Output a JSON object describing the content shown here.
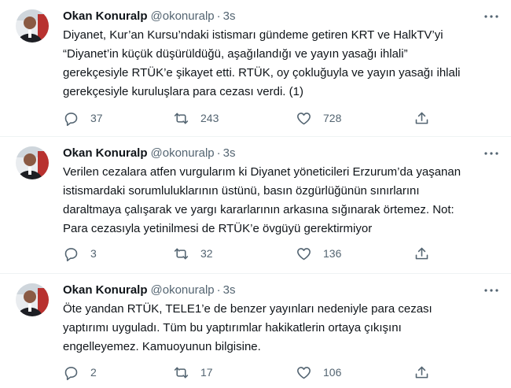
{
  "tweets": [
    {
      "author_name": "Okan Konuralp",
      "handle": "@okonuralp",
      "separator": "·",
      "time": "3s",
      "lines": [
        "Diyanet, Kur’an Kursu’ndaki istismarı gündeme getiren KRT ve HalkTV’yi",
        "“Diyanet’in küçük düşürüldüğü, aşağılandığı ve yayın yasağı ihlali”",
        "gerekçesiyle RTÜK’e şikayet etti. RTÜK, oy çokluğuyla ve yayın yasağı ihlali",
        "gerekçesiyle kuruluşlara para cezası verdi. (1)"
      ],
      "replies": "37",
      "retweets": "243",
      "likes": "728"
    },
    {
      "author_name": "Okan Konuralp",
      "handle": "@okonuralp",
      "separator": "·",
      "time": "3s",
      "lines": [
        "Verilen cezalara atfen vurgularım ki Diyanet yöneticileri Erzurum’da yaşanan",
        "istismardaki sorumluluklarının üstünü, basın özgürlüğünün sınırlarını",
        "daraltmaya çalışarak ve yargı kararlarının arkasına sığınarak örtemez. Not:",
        "Para cezasıyla yetinilmesi de RTÜK’e övgüyü gerektirmiyor"
      ],
      "replies": "3",
      "retweets": "32",
      "likes": "136"
    },
    {
      "author_name": "Okan Konuralp",
      "handle": "@okonuralp",
      "separator": "·",
      "time": "3s",
      "lines": [
        "Öte yandan RTÜK, TELE1’e de benzer yayınları nedeniyle para cezası",
        "yaptırımı uyguladı. Tüm bu yaptırımlar hakikatlerin ortaya çıkışını",
        "engelleyemez. Kamuoyunun bilgisine."
      ],
      "replies": "2",
      "retweets": "17",
      "likes": "106"
    }
  ],
  "icons": {
    "reply": "reply-icon",
    "retweet": "retweet-icon",
    "like": "like-icon",
    "share": "share-icon",
    "more": "more-icon"
  },
  "colors": {
    "text": "#0f1419",
    "secondary": "#536471",
    "divider": "#eff3f4"
  }
}
